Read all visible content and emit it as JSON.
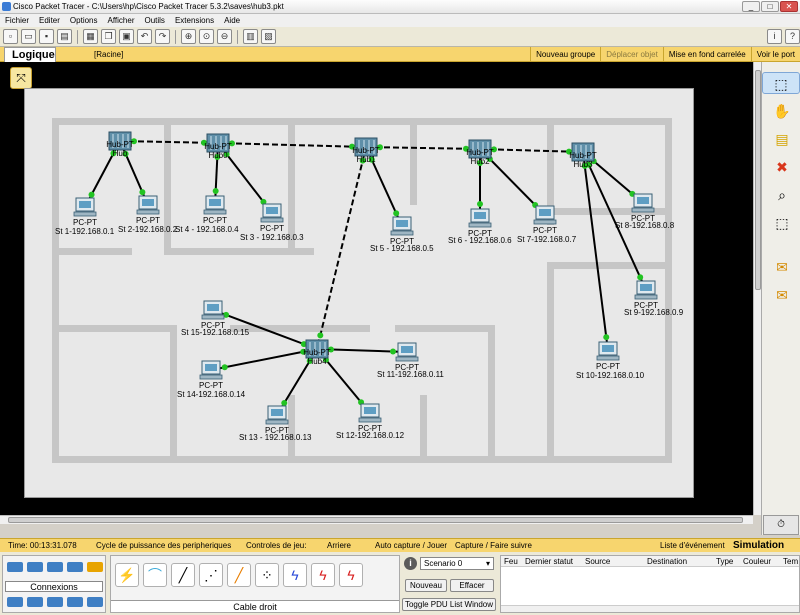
{
  "window": {
    "title": "Cisco Packet Tracer - C:\\Users\\hp\\Cisco Packet Tracer 5.3.2\\saves\\hub3.pkt"
  },
  "menu": [
    "Fichier",
    "Editer",
    "Options",
    "Afficher",
    "Outils",
    "Extensions",
    "Aide"
  ],
  "toolbar": {
    "icons": [
      "new-file-icon",
      "open-folder-icon",
      "save-icon",
      "print-icon",
      "wizard-icon",
      "copy-icon",
      "paste-icon",
      "undo-icon",
      "redo-icon",
      "zoom-in-icon",
      "zoom-reset-icon",
      "zoom-out-icon",
      "palette-icon",
      "custom-device-icon"
    ],
    "info_glyph": "i",
    "help_glyph": "?"
  },
  "logical_bar": {
    "tab": "Logique",
    "root": "[Racine]",
    "new_group": "Nouveau groupe",
    "move_object": "Déplacer objet",
    "set_background": "Mise en fond carrelée",
    "viewport": "Voir le port"
  },
  "devices": {
    "hubs": [
      {
        "type": "Hub-PT",
        "name": "Hub"
      },
      {
        "type": "Hub-PT",
        "name": "Hub0"
      },
      {
        "type": "Hub-PT",
        "name": "Hub1"
      },
      {
        "type": "Hub-PT",
        "name": "Hub2"
      },
      {
        "type": "Hub-PT",
        "name": "Hub3"
      },
      {
        "type": "Hub-PT",
        "name": "Hub4"
      }
    ],
    "pcs": [
      {
        "type": "PC-PT",
        "name": "St 1-192.168.0.1"
      },
      {
        "type": "PC-PT",
        "name": "St 2-192.168.0.2"
      },
      {
        "type": "PC-PT",
        "name": "St 4 - 192.168.0.4"
      },
      {
        "type": "PC-PT",
        "name": "St 3 - 192.168.0.3"
      },
      {
        "type": "PC-PT",
        "name": "St 5 - 192.168.0.5"
      },
      {
        "type": "PC-PT",
        "name": "St 6 - 192.168.0.6"
      },
      {
        "type": "PC-PT",
        "name": "St 7-192.168.0.7"
      },
      {
        "type": "PC-PT",
        "name": "St 8-192.168.0.8"
      },
      {
        "type": "PC-PT",
        "name": "St 9-192.168.0.9"
      },
      {
        "type": "PC-PT",
        "name": "St 10-192.168.0.10"
      },
      {
        "type": "PC-PT",
        "name": "St 15-192.168.0.15"
      },
      {
        "type": "PC-PT",
        "name": "St 14-192.168.0.14"
      },
      {
        "type": "PC-PT",
        "name": "St 11-192.168.0.11"
      },
      {
        "type": "PC-PT",
        "name": "St 13 - 192.168.0.13"
      },
      {
        "type": "PC-PT",
        "name": "St 12-192.168.0.12"
      }
    ]
  },
  "status": {
    "time": "Time: 00:13:31.078",
    "power_cycle": "Cycle de puissance des peripheriques",
    "game_controls": "Controles de jeu:",
    "back": "Arriere",
    "auto_capture": "Auto capture / Jouer",
    "capture": "Capture / Faire suivre",
    "event_list": "Liste d'événement",
    "simulation": "Simulation"
  },
  "bottom": {
    "connections_label": "Connexions",
    "cable_label": "Cable droit",
    "scenario": "Scenario 0",
    "new_button": "Nouveau",
    "delete_button": "Effacer",
    "toggle_pdu": "Toggle PDU List Window",
    "pdu_columns": [
      "Feu",
      "Dernier statut",
      "Source",
      "Destination",
      "Type",
      "Couleur",
      "Tem"
    ]
  },
  "colors": {
    "link_dot": "#22c322",
    "wall": "#c6c6c6",
    "hub": "#5f8fa8",
    "status_bar": "#f7d56e"
  }
}
